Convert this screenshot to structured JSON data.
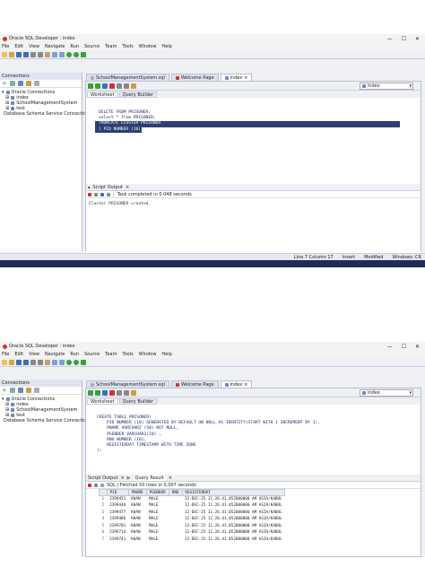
{
  "app": {
    "title": "Oracle SQL Developer : index",
    "window_controls": [
      "—",
      "☐",
      "✕"
    ],
    "menu": [
      "File",
      "Edit",
      "View",
      "Navigate",
      "Run",
      "Source",
      "Team",
      "Tools",
      "Window",
      "Help"
    ]
  },
  "connections_panel": {
    "title": "Connections",
    "tree": [
      {
        "label": "Oracle Connections",
        "level": 0
      },
      {
        "label": "index",
        "level": 1
      },
      {
        "label": "SchoolManagementSystem",
        "level": 1
      },
      {
        "label": "test",
        "level": 1
      },
      {
        "label": "Database Schema Service Connections",
        "level": 0
      }
    ]
  },
  "doc_tabs": [
    "SchoolManagementSystem.sql",
    "Welcome Page",
    "index"
  ],
  "sub_tabs": [
    "Worksheet",
    "Query Builder"
  ],
  "connection_selector": "index",
  "screenshot1": {
    "code_lines": [
      "DELETE FROM PRISONER;",
      "select * from PRISONER;",
      "",
      "",
      "TRUNCATE CLUSTER PRISONER",
      "( PID NUMBER (10));"
    ],
    "output_tab": "Script Output",
    "output_status": "Task completed in 0.048 seconds",
    "output_text": "Cluster PRISONER created.",
    "status_items": [
      "Line 7 Column 17",
      "Insert",
      "Modified",
      "Windows: CR"
    ]
  },
  "screenshot2": {
    "code_lines": [
      "CREATE TABLE PRISONER(",
      "    PID NUMBER (10) GENERATED BY DEFAULT ON NULL AS IDENTITY(START WITH 1 INCREMENT BY 1),",
      "    PNAME VARCHAR2 (50) NOT NULL,",
      "    PGENDER VARCHAR2(10) ,",
      "    RNO NUMBER (10),",
      "    REGISTERDAT TIMESTAMP WITH TIME ZONE",
      ");"
    ],
    "output_tabs": [
      "Script Output",
      "Query Result"
    ],
    "query_status": "SQL  |  Fetched 50 rows in 0.007 seconds",
    "columns": [
      "PID",
      "PNAME",
      "PGENDER",
      "RNO",
      "REGISTERDAT"
    ],
    "rows": [
      [
        "1",
        "2399451",
        "KHAN",
        "MALE",
        "",
        "12-DEC-25 11.26.41.052000000 AM ASIA/KABUL"
      ],
      [
        "2",
        "2399448",
        "KHAN",
        "MALE",
        "",
        "12-DEC-25 11.26.41.052000000 AM ASIA/KABUL"
      ],
      [
        "3",
        "2399477",
        "KHAN",
        "MALE",
        "",
        "12-DEC-25 11.26.41.052000000 AM ASIA/KABUL"
      ],
      [
        "4",
        "2399486",
        "KHAN",
        "MALE",
        "",
        "12-DEC-25 11.26.41.052000000 AM ASIA/KABUL"
      ],
      [
        "5",
        "2399701",
        "KHAN",
        "MALE",
        "",
        "12-DEC-25 11.26.41.052000000 AM ASIA/KABUL"
      ],
      [
        "6",
        "2399714",
        "KHAN",
        "MALE",
        "",
        "12-DEC-25 11.26.41.052000000 AM ASIA/KABUL"
      ],
      [
        "7",
        "2399741",
        "KHAN",
        "MALE",
        "",
        "12-DEC-25 11.26.41.052000000 AM ASIA/KABUL"
      ]
    ]
  },
  "colors": {
    "toolbar_green": "#3aa03a",
    "toolbar_blue": "#3d6fb5",
    "highlight": "#2c3f73",
    "desktop": "#1d2b57"
  }
}
